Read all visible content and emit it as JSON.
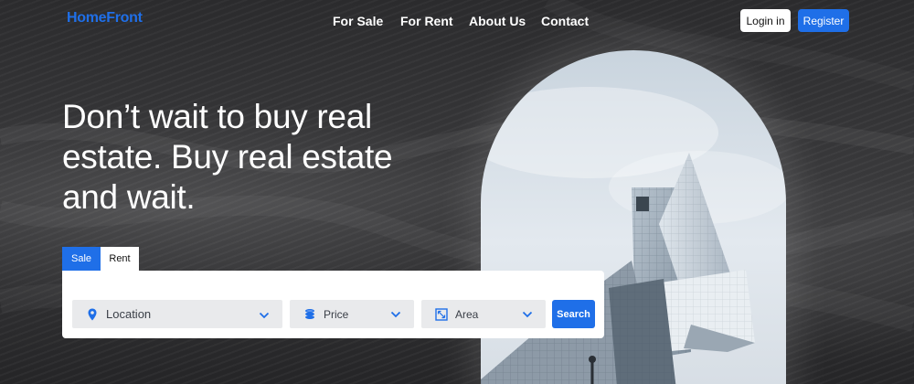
{
  "brand": {
    "logo_text": "HomeFront",
    "accent": "#1f6fe8"
  },
  "nav": {
    "items": [
      "For Sale",
      "For Rent",
      "About Us",
      "Contact"
    ]
  },
  "auth": {
    "login_label": "Login in",
    "register_label": "Register"
  },
  "hero": {
    "headline_line1": "Don’t wait to buy real",
    "headline_line2": "estate. Buy real estate",
    "headline_line3": "and wait."
  },
  "search": {
    "tabs": [
      {
        "label": "Sale",
        "active": true
      },
      {
        "label": "Rent",
        "active": false
      }
    ],
    "fields": {
      "location": {
        "label": "Location",
        "icon": "map-pin-icon"
      },
      "price": {
        "label": "Price",
        "icon": "coins-icon"
      },
      "area": {
        "label": "Area",
        "icon": "area-expand-icon"
      }
    },
    "submit_label": "Search"
  }
}
